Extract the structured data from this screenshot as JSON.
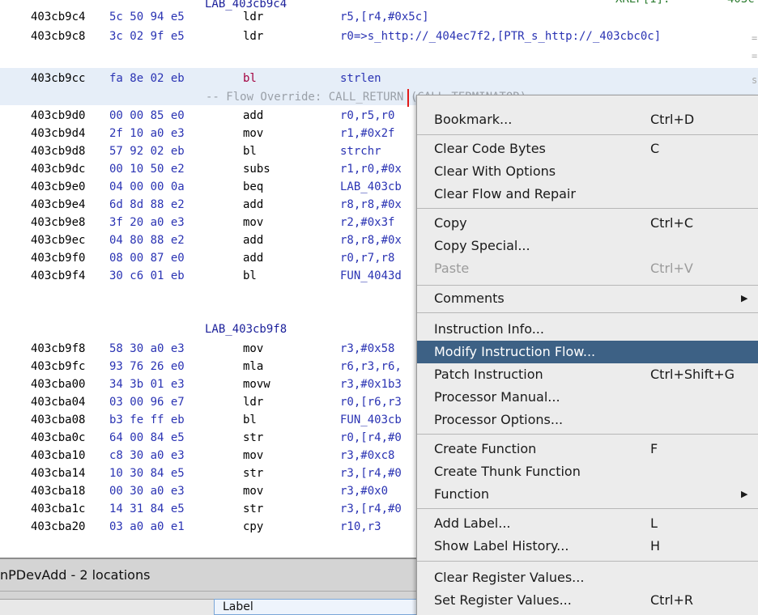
{
  "listing": {
    "top_partial": {
      "label": "LAB_403cb9c4",
      "xref": "XREF[1]:",
      "xref_addr": "403c"
    },
    "rows": [
      {
        "addr": "403cb9c4",
        "bytes": "5c 50 94 e5",
        "mnemonic": "ldr",
        "operands": "r5,[r4,#0x5c]",
        "is_call": false
      },
      {
        "addr": "403cb9c8",
        "bytes": "3c 02 9f e5",
        "mnemonic": "ldr",
        "operands": "r0=>s_http://_404ec7f2,[PTR_s_http://_403cbc0c]",
        "is_call": false
      },
      {
        "addr": "403cb9cc",
        "bytes": "fa 8e 02 eb",
        "mnemonic": "bl",
        "operands": "strlen",
        "is_call": true
      },
      {
        "addr": "403cb9d0",
        "bytes": "00 00 85 e0",
        "mnemonic": "add",
        "operands": "r0,r5,r0",
        "is_call": false
      },
      {
        "addr": "403cb9d4",
        "bytes": "2f 10 a0 e3",
        "mnemonic": "mov",
        "operands": "r1,#0x2f",
        "is_call": false
      },
      {
        "addr": "403cb9d8",
        "bytes": "57 92 02 eb",
        "mnemonic": "bl",
        "operands": "strchr",
        "is_call": false
      },
      {
        "addr": "403cb9dc",
        "bytes": "00 10 50 e2",
        "mnemonic": "subs",
        "operands": "r1,r0,#0x",
        "is_call": false
      },
      {
        "addr": "403cb9e0",
        "bytes": "04 00 00 0a",
        "mnemonic": "beq",
        "operands": "LAB_403cb",
        "is_call": false
      },
      {
        "addr": "403cb9e4",
        "bytes": "6d 8d 88 e2",
        "mnemonic": "add",
        "operands": "r8,r8,#0x",
        "is_call": false
      },
      {
        "addr": "403cb9e8",
        "bytes": "3f 20 a0 e3",
        "mnemonic": "mov",
        "operands": "r2,#0x3f",
        "is_call": false
      },
      {
        "addr": "403cb9ec",
        "bytes": "04 80 88 e2",
        "mnemonic": "add",
        "operands": "r8,r8,#0x",
        "is_call": false
      },
      {
        "addr": "403cb9f0",
        "bytes": "08 00 87 e0",
        "mnemonic": "add",
        "operands": "r0,r7,r8",
        "is_call": false
      },
      {
        "addr": "403cb9f4",
        "bytes": "30 c6 01 eb",
        "mnemonic": "bl",
        "operands": "FUN_4043d",
        "is_call": false
      },
      {
        "addr": "403cb9f8",
        "bytes": "58 30 a0 e3",
        "mnemonic": "mov",
        "operands": "r3,#0x58",
        "is_call": false
      },
      {
        "addr": "403cb9fc",
        "bytes": "93 76 26 e0",
        "mnemonic": "mla",
        "operands": "r6,r3,r6,",
        "is_call": false
      },
      {
        "addr": "403cba00",
        "bytes": "34 3b 01 e3",
        "mnemonic": "movw",
        "operands": "r3,#0x1b3",
        "is_call": false
      },
      {
        "addr": "403cba04",
        "bytes": "03 00 96 e7",
        "mnemonic": "ldr",
        "operands": "r0,[r6,r3",
        "is_call": false
      },
      {
        "addr": "403cba08",
        "bytes": "b3 fe ff eb",
        "mnemonic": "bl",
        "operands": "FUN_403cb",
        "is_call": false
      },
      {
        "addr": "403cba0c",
        "bytes": "64 00 84 e5",
        "mnemonic": "str",
        "operands": "r0,[r4,#0",
        "is_call": false
      },
      {
        "addr": "403cba10",
        "bytes": "c8 30 a0 e3",
        "mnemonic": "mov",
        "operands": "r3,#0xc8",
        "is_call": false
      },
      {
        "addr": "403cba14",
        "bytes": "10 30 84 e5",
        "mnemonic": "str",
        "operands": "r3,[r4,#0",
        "is_call": false
      },
      {
        "addr": "403cba18",
        "bytes": "00 30 a0 e3",
        "mnemonic": "mov",
        "operands": "r3,#0x0",
        "is_call": false
      },
      {
        "addr": "403cba1c",
        "bytes": "14 31 84 e5",
        "mnemonic": "str",
        "operands": "r3,[r4,#0",
        "is_call": false
      },
      {
        "addr": "403cba20",
        "bytes": "03 a0 a0 e1",
        "mnemonic": "cpy",
        "operands": "r10,r3",
        "is_call": false
      }
    ],
    "flow_override": "-- Flow Override: CALL_RETURN (CALL_TERMINATOR)",
    "label_b9f8": "LAB_403cb9f8",
    "eq_marks": [
      "=",
      "=",
      "s"
    ]
  },
  "bottom_panel": {
    "title": "nPDevAdd - 2 locations",
    "column_header": "Label"
  },
  "context_menu": {
    "items": [
      {
        "label": "Bookmark...",
        "shortcut": "Ctrl+D"
      },
      {
        "label": "Clear Code Bytes",
        "shortcut": "C"
      },
      {
        "label": "Clear With Options",
        "shortcut": ""
      },
      {
        "label": "Clear Flow and Repair",
        "shortcut": ""
      },
      {
        "label": "Copy",
        "shortcut": "Ctrl+C"
      },
      {
        "label": "Copy Special...",
        "shortcut": ""
      },
      {
        "label": "Paste",
        "shortcut": "Ctrl+V",
        "disabled": true
      },
      {
        "label": "Comments",
        "shortcut": "",
        "submenu": true
      },
      {
        "label": "Instruction Info...",
        "shortcut": ""
      },
      {
        "label": "Modify Instruction Flow...",
        "shortcut": "",
        "selected": true
      },
      {
        "label": "Patch Instruction",
        "shortcut": "Ctrl+Shift+G"
      },
      {
        "label": "Processor Manual...",
        "shortcut": ""
      },
      {
        "label": "Processor Options...",
        "shortcut": ""
      },
      {
        "label": "Create Function",
        "shortcut": "F"
      },
      {
        "label": "Create Thunk Function",
        "shortcut": ""
      },
      {
        "label": "Function",
        "shortcut": "",
        "submenu": true
      },
      {
        "label": "Add Label...",
        "shortcut": "L"
      },
      {
        "label": "Show Label History...",
        "shortcut": "H"
      },
      {
        "label": "Clear Register Values...",
        "shortcut": ""
      },
      {
        "label": "Set Register Values...",
        "shortcut": "Ctrl+R"
      }
    ],
    "submenu_glyph": "▶"
  }
}
